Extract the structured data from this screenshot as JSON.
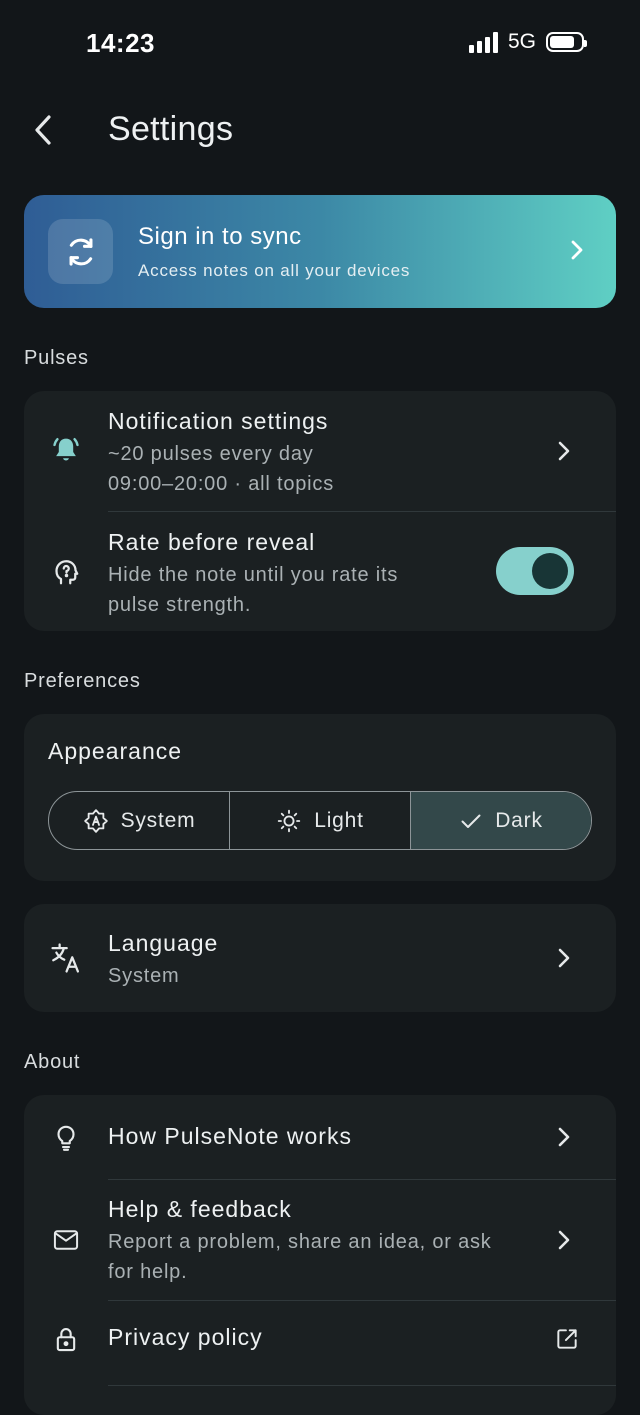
{
  "status_bar": {
    "time": "14:23",
    "network": "5G",
    "signal_bars": 4,
    "battery_level": 0.8
  },
  "header": {
    "title": "Settings"
  },
  "sync_card": {
    "title": "Sign in to sync",
    "subtitle": "Access notes on all your devices"
  },
  "sections": {
    "pulses": "Pulses",
    "preferences": "Preferences",
    "about": "About"
  },
  "pulses": {
    "notification": {
      "title": "Notification settings",
      "line1": "~20 pulses every day",
      "line2": "09:00–20:00 · all topics",
      "icon": "bell-icon"
    },
    "rate_reveal": {
      "title": "Rate before reveal",
      "subtitle": "Hide the note until you rate its pulse strength.",
      "enabled": true,
      "icon": "head-question-icon"
    }
  },
  "appearance": {
    "title": "Appearance",
    "options": [
      {
        "label": "System",
        "icon": "auto-brightness-icon",
        "selected": false
      },
      {
        "label": "Light",
        "icon": "sun-icon",
        "selected": false
      },
      {
        "label": "Dark",
        "icon": "check-icon",
        "selected": true
      }
    ]
  },
  "language": {
    "title": "Language",
    "value": "System",
    "icon": "translate-icon"
  },
  "about": {
    "how_it_works": {
      "title": "How PulseNote works",
      "icon": "lightbulb-icon"
    },
    "help": {
      "title": "Help & feedback",
      "subtitle": "Report a problem, share an idea, or ask for help.",
      "icon": "mail-icon"
    },
    "privacy": {
      "title": "Privacy policy",
      "icon": "lock-icon"
    }
  },
  "colors": {
    "background": "#121619",
    "card": "#1b2022",
    "accent": "#86d0cc",
    "sync_gradient_start": "#2f5d95",
    "sync_gradient_end": "#5fcfc4"
  }
}
